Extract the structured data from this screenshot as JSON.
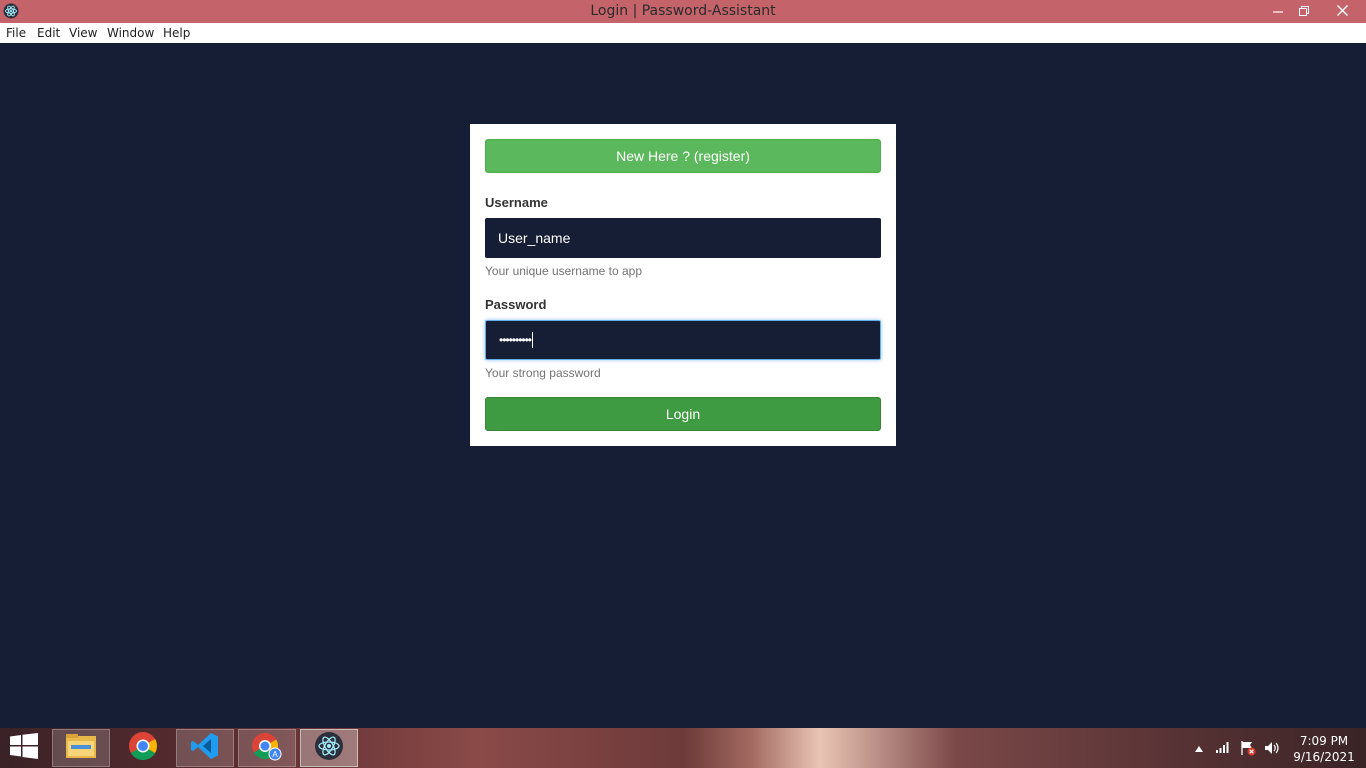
{
  "window": {
    "title": "Login | Password-Assistant",
    "icon": "electron-icon",
    "controls": {
      "minimize": "minimize-icon",
      "maximize": "restore-icon",
      "close": "close-icon"
    }
  },
  "menu": {
    "items": [
      {
        "label": "File"
      },
      {
        "label": "Edit"
      },
      {
        "label": "View"
      },
      {
        "label": "Window"
      },
      {
        "label": "Help"
      }
    ]
  },
  "login": {
    "register_label": "New Here ? (register)",
    "username": {
      "label": "Username",
      "value": "User_name",
      "help": "Your unique username to app"
    },
    "password": {
      "label": "Password",
      "value": "••••••••••",
      "help": "Your strong password"
    },
    "submit_label": "Login"
  },
  "colors": {
    "background": "#161e36",
    "titlebar": "#c5636a",
    "register_button": "#5cb85c",
    "login_button": "#3f9b41",
    "input_background": "#161e36"
  },
  "taskbar": {
    "items": [
      {
        "name": "file-explorer-icon"
      },
      {
        "name": "chrome-icon"
      },
      {
        "name": "vscode-icon"
      },
      {
        "name": "chrome-apps-icon"
      },
      {
        "name": "electron-app-icon"
      }
    ],
    "tray": [
      "show-hidden-icons-icon",
      "network-icon",
      "action-center-icon",
      "volume-icon"
    ],
    "clock": {
      "time": "7:09 PM",
      "date": "9/16/2021"
    }
  }
}
